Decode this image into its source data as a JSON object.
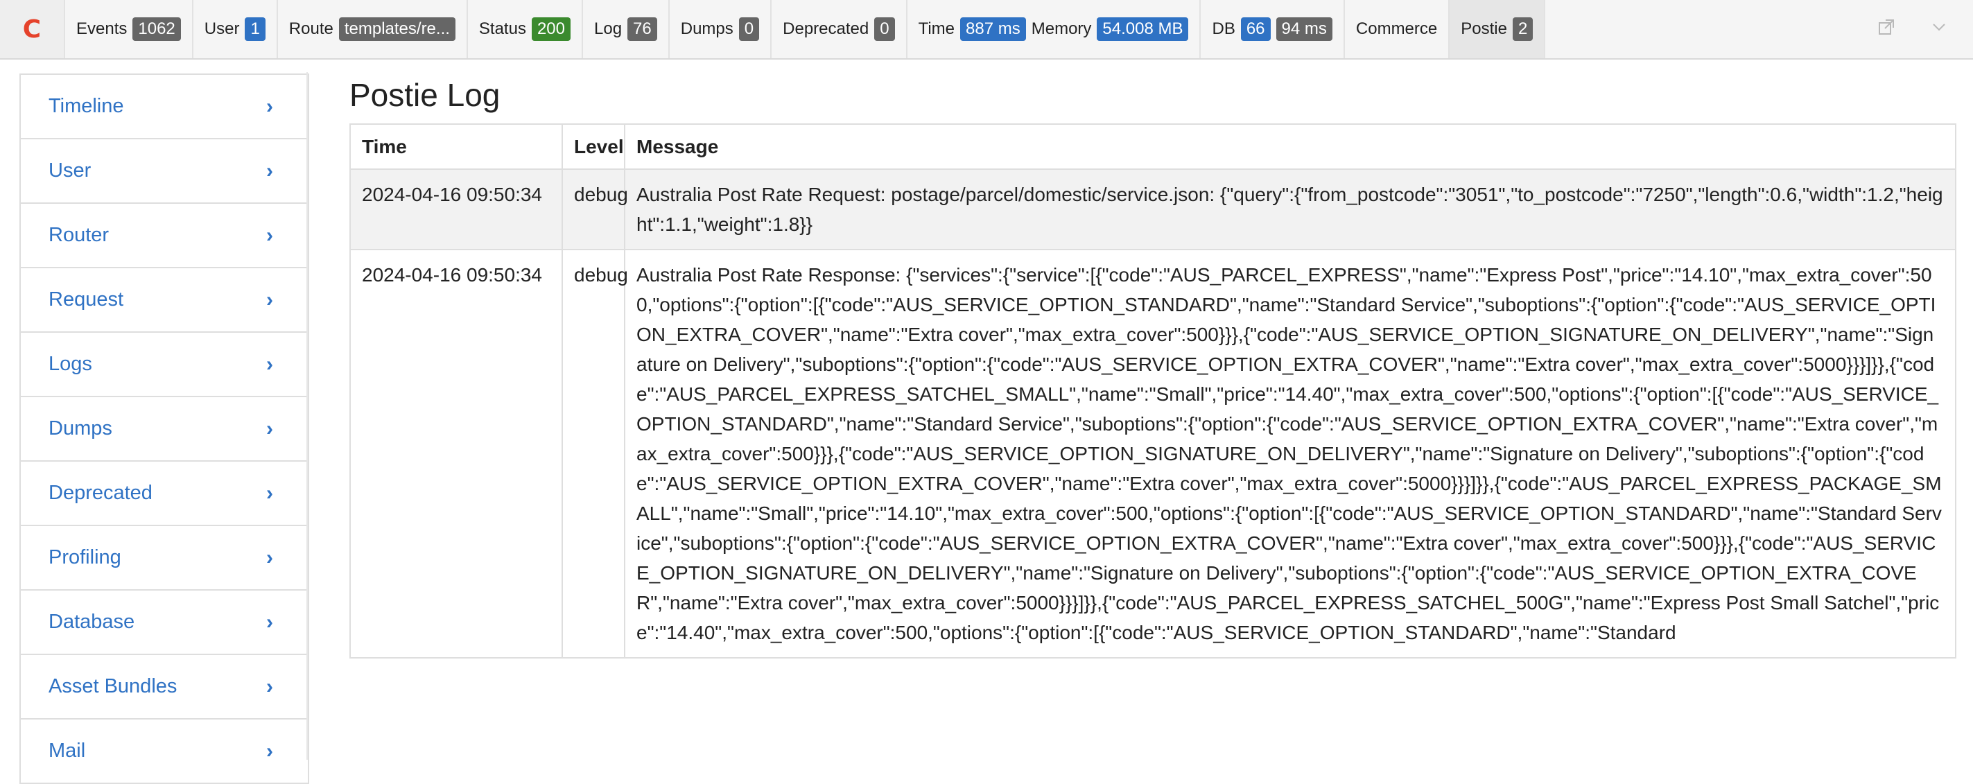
{
  "toolbar": {
    "logo": "C",
    "items": [
      {
        "label": "Events",
        "value": "1062",
        "color": "#666666"
      },
      {
        "label": "User",
        "value": "1",
        "color": "#2f72c4"
      },
      {
        "label": "Route",
        "value": "templates/re...",
        "color": "#666666"
      },
      {
        "label": "Status",
        "value": "200",
        "color": "#3b8a2e"
      },
      {
        "label": "Log",
        "value": "76",
        "color": "#666666"
      },
      {
        "label": "Dumps",
        "value": "0",
        "color": "#666666"
      },
      {
        "label": "Deprecated",
        "value": "0",
        "color": "#666666"
      }
    ],
    "time_label": "Time",
    "time_value": "887 ms",
    "memory_label": "Memory",
    "memory_value": "54.008 MB",
    "db_label": "DB",
    "db_count": "66",
    "db_time": "94 ms",
    "commerce_label": "Commerce",
    "postie_label": "Postie",
    "postie_value": "2",
    "icons": [
      "external-link-icon",
      "chevron-down-icon"
    ]
  },
  "sidebar": {
    "items": [
      {
        "label": "Timeline"
      },
      {
        "label": "User"
      },
      {
        "label": "Router"
      },
      {
        "label": "Request"
      },
      {
        "label": "Logs"
      },
      {
        "label": "Dumps"
      },
      {
        "label": "Deprecated"
      },
      {
        "label": "Profiling"
      },
      {
        "label": "Database"
      },
      {
        "label": "Asset Bundles"
      },
      {
        "label": "Mail"
      }
    ],
    "chevron": "›"
  },
  "main": {
    "title": "Postie Log",
    "columns": [
      "Time",
      "Level",
      "Message"
    ],
    "rows": [
      {
        "time": "2024-04-16 09:50:34",
        "level": "debug",
        "message": "Australia Post Rate Request: postage/parcel/domestic/service.json: {\"query\":{\"from_postcode\":\"3051\",\"to_postcode\":\"7250\",\"length\":0.6,\"width\":1.2,\"height\":1.1,\"weight\":1.8}}"
      },
      {
        "time": "2024-04-16 09:50:34",
        "level": "debug",
        "message": "Australia Post Rate Response: {\"services\":{\"service\":[{\"code\":\"AUS_PARCEL_EXPRESS\",\"name\":\"Express Post\",\"price\":\"14.10\",\"max_extra_cover\":500,\"options\":{\"option\":[{\"code\":\"AUS_SERVICE_OPTION_STANDARD\",\"name\":\"Standard Service\",\"suboptions\":{\"option\":{\"code\":\"AUS_SERVICE_OPTION_EXTRA_COVER\",\"name\":\"Extra cover\",\"max_extra_cover\":500}}},{\"code\":\"AUS_SERVICE_OPTION_SIGNATURE_ON_DELIVERY\",\"name\":\"Signature on Delivery\",\"suboptions\":{\"option\":{\"code\":\"AUS_SERVICE_OPTION_EXTRA_COVER\",\"name\":\"Extra cover\",\"max_extra_cover\":5000}}}]}},{\"code\":\"AUS_PARCEL_EXPRESS_SATCHEL_SMALL\",\"name\":\"Small\",\"price\":\"14.40\",\"max_extra_cover\":500,\"options\":{\"option\":[{\"code\":\"AUS_SERVICE_OPTION_STANDARD\",\"name\":\"Standard Service\",\"suboptions\":{\"option\":{\"code\":\"AUS_SERVICE_OPTION_EXTRA_COVER\",\"name\":\"Extra cover\",\"max_extra_cover\":500}}},{\"code\":\"AUS_SERVICE_OPTION_SIGNATURE_ON_DELIVERY\",\"name\":\"Signature on Delivery\",\"suboptions\":{\"option\":{\"code\":\"AUS_SERVICE_OPTION_EXTRA_COVER\",\"name\":\"Extra cover\",\"max_extra_cover\":5000}}}]}},{\"code\":\"AUS_PARCEL_EXPRESS_PACKAGE_SMALL\",\"name\":\"Small\",\"price\":\"14.10\",\"max_extra_cover\":500,\"options\":{\"option\":[{\"code\":\"AUS_SERVICE_OPTION_STANDARD\",\"name\":\"Standard Service\",\"suboptions\":{\"option\":{\"code\":\"AUS_SERVICE_OPTION_EXTRA_COVER\",\"name\":\"Extra cover\",\"max_extra_cover\":500}}},{\"code\":\"AUS_SERVICE_OPTION_SIGNATURE_ON_DELIVERY\",\"name\":\"Signature on Delivery\",\"suboptions\":{\"option\":{\"code\":\"AUS_SERVICE_OPTION_EXTRA_COVER\",\"name\":\"Extra cover\",\"max_extra_cover\":5000}}}]}},{\"code\":\"AUS_PARCEL_EXPRESS_SATCHEL_500G\",\"name\":\"Express Post Small Satchel\",\"price\":\"14.40\",\"max_extra_cover\":500,\"options\":{\"option\":[{\"code\":\"AUS_SERVICE_OPTION_STANDARD\",\"name\":\"Standard"
      }
    ]
  },
  "colors": {
    "link": "#2f72c4",
    "logo": "#e5422b",
    "badge_gray": "#666666",
    "badge_blue": "#2f72c4",
    "badge_green": "#3b8a2e",
    "stripe": "#f2f2f2"
  }
}
